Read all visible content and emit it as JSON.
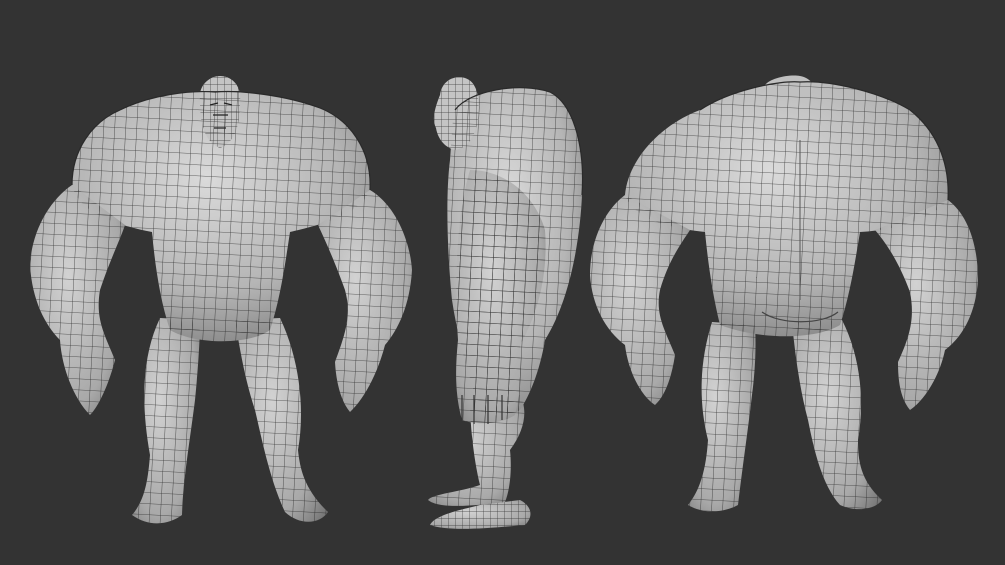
{
  "scene": {
    "background_color": "#333333",
    "mesh_fill_color": "#b8b8b8",
    "mesh_highlight_color": "#d9d9d9",
    "mesh_shadow_color": "#7a7a7a",
    "wire_color": "#1e1e1e"
  },
  "views": [
    {
      "id": "front",
      "name": "front-view"
    },
    {
      "id": "side",
      "name": "side-view"
    },
    {
      "id": "back",
      "name": "back-view"
    }
  ]
}
